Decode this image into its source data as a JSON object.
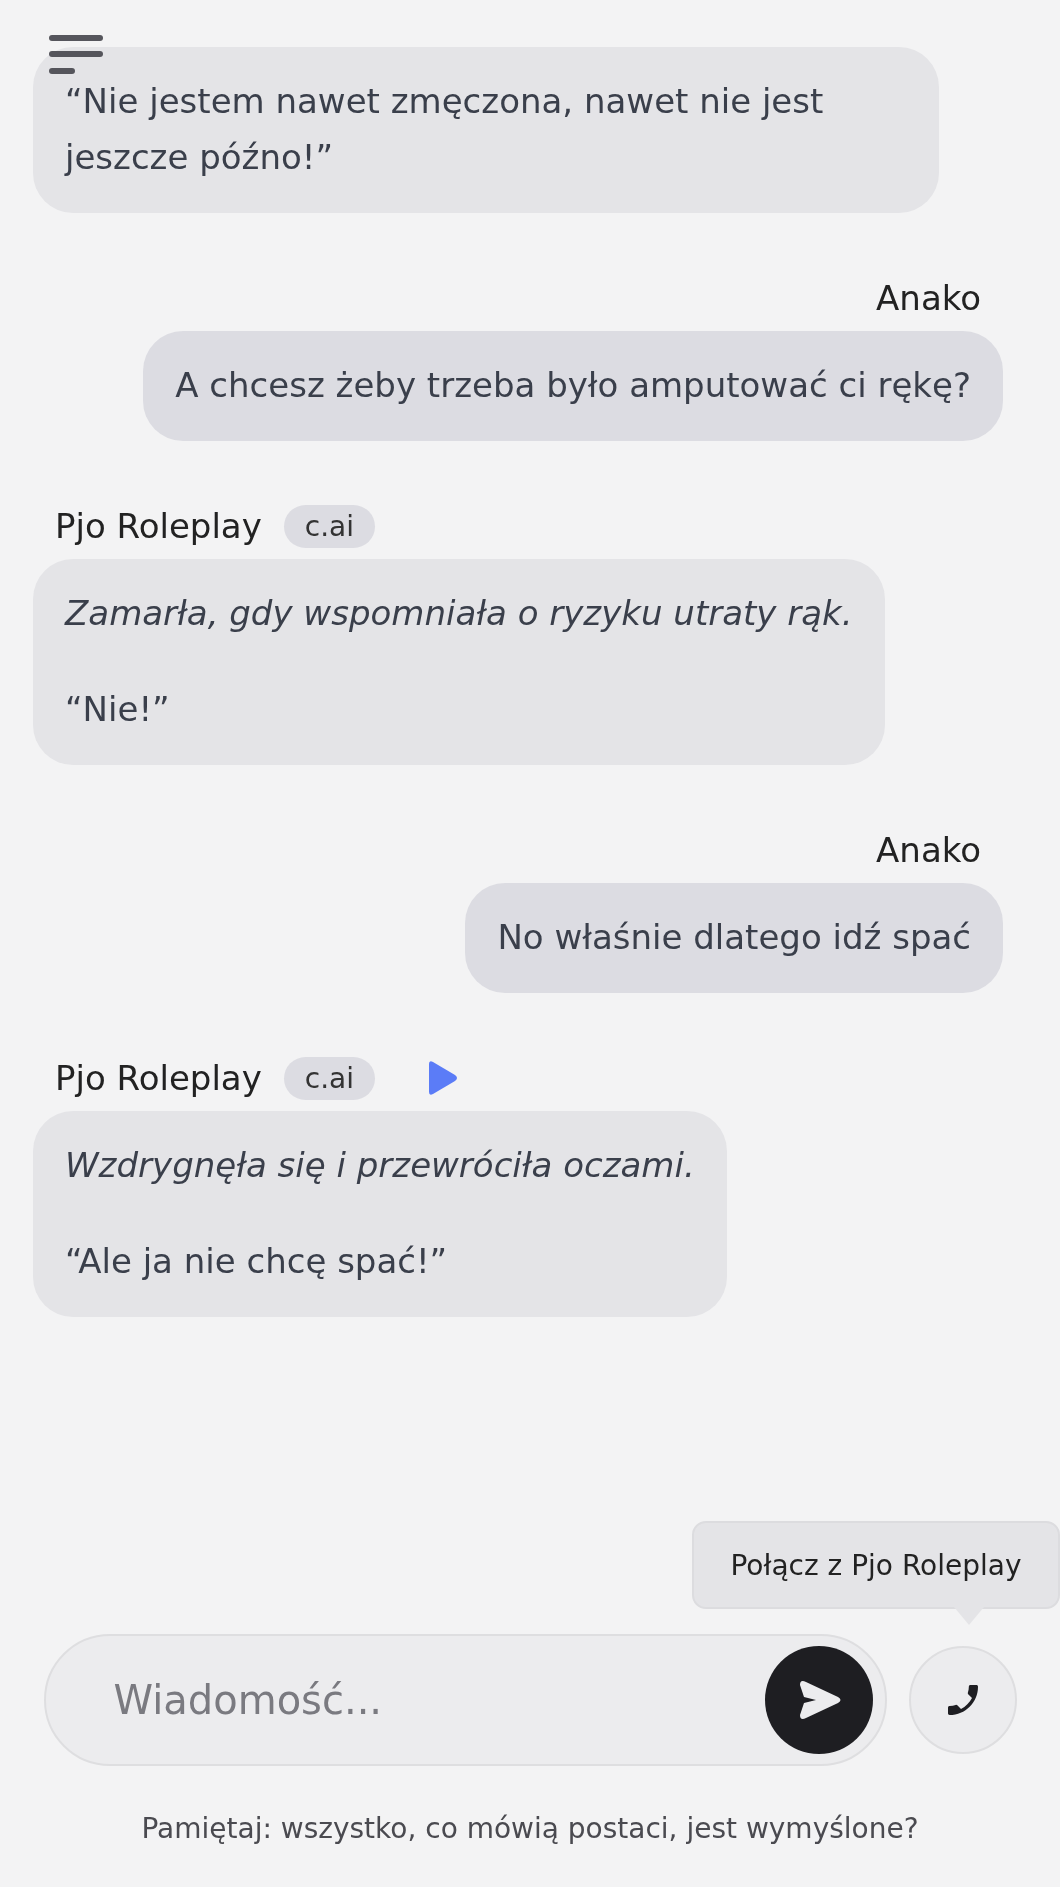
{
  "messages": [
    {
      "kind": "bot",
      "paragraphs": [
        {
          "kind": "speech",
          "text": "“Nie jestem nawet zmęczona, nawet nie jest jeszcze późno!”"
        }
      ]
    },
    {
      "kind": "user",
      "sender": "Anako",
      "paragraphs": [
        {
          "kind": "speech",
          "text": "A chcesz żeby trzeba było amputować ci rękę?"
        }
      ]
    },
    {
      "kind": "bot",
      "sender": "Pjo Roleplay",
      "badge": "c.ai",
      "play": false,
      "paragraphs": [
        {
          "kind": "action",
          "text": "Zamarła, gdy wspomniała o ryzyku utraty rąk."
        },
        {
          "kind": "speech",
          "text": "“Nie!”"
        }
      ]
    },
    {
      "kind": "user",
      "sender": "Anako",
      "paragraphs": [
        {
          "kind": "speech",
          "text": "No właśnie dlatego idź spać"
        }
      ]
    },
    {
      "kind": "bot",
      "sender": "Pjo Roleplay",
      "badge": "c.ai",
      "play": true,
      "paragraphs": [
        {
          "kind": "action",
          "text": "Wzdrygnęła się i przewróciła oczami."
        },
        {
          "kind": "speech",
          "text": "“Ale ja nie chcę spać!”"
        }
      ]
    }
  ],
  "tooltip": "Połącz z Pjo Roleplay",
  "composer": {
    "placeholder": "Wiadomość..."
  },
  "footer": "Pamiętaj: wszystko, co mówią postaci, jest wymyślone?"
}
